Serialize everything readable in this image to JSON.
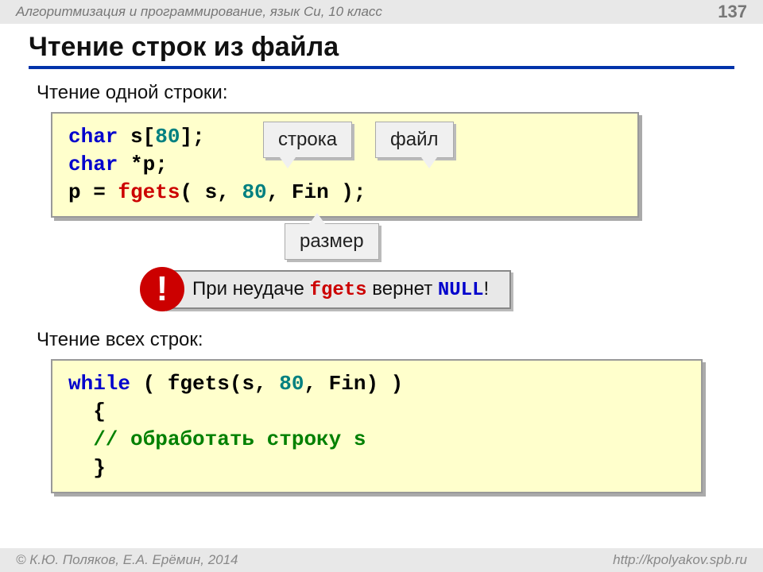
{
  "header": {
    "breadcrumb": "Алгоритмизация и программирование, язык Си, 10 класс",
    "page": "137"
  },
  "title": "Чтение строк из файла",
  "section1": {
    "heading": "Чтение одной строки:",
    "code": {
      "l1a": "char",
      "l1b": " s[",
      "l1c": "80",
      "l1d": "];",
      "l2a": "char",
      "l2b": " *p;",
      "l3a": "p = ",
      "l3b": "fgets",
      "l3c": "( s, ",
      "l3d": "80",
      "l3e": ", Fin );"
    },
    "callouts": {
      "stroka": "строка",
      "fail": "файл",
      "razmer": "размер"
    }
  },
  "note": {
    "badge": "!",
    "t1": "При неудаче ",
    "t2": "fgets",
    "t3": " вернет ",
    "t4": "NULL",
    "t5": "!"
  },
  "section2": {
    "heading": "Чтение всех строк:",
    "code": {
      "l1a": "while",
      "l1b": " ( fgets(s, ",
      "l1c": "80",
      "l1d": ", Fin)  )",
      "l2": "  {",
      "l3": "  // обработать строку s",
      "l4": "  }"
    }
  },
  "footer": {
    "copyright": "© К.Ю. Поляков, Е.А. Ерёмин, 2014",
    "url": "http://kpolyakov.spb.ru"
  }
}
